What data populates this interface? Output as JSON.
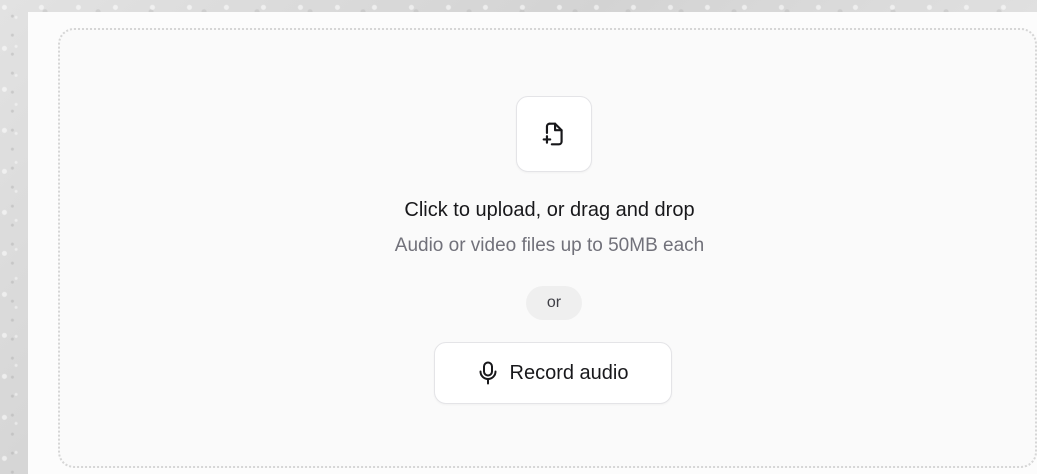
{
  "upload": {
    "icon": "file-plus-icon",
    "title": "Click to upload, or drag and drop",
    "subtitle": "Audio or video files up to 50MB each"
  },
  "divider": {
    "label": "or"
  },
  "record": {
    "icon": "microphone-icon",
    "label": "Record audio"
  },
  "colors": {
    "text_primary": "#18181b",
    "text_muted": "#71717a",
    "border": "#e4e4e7",
    "pill_bg": "#efefef"
  }
}
